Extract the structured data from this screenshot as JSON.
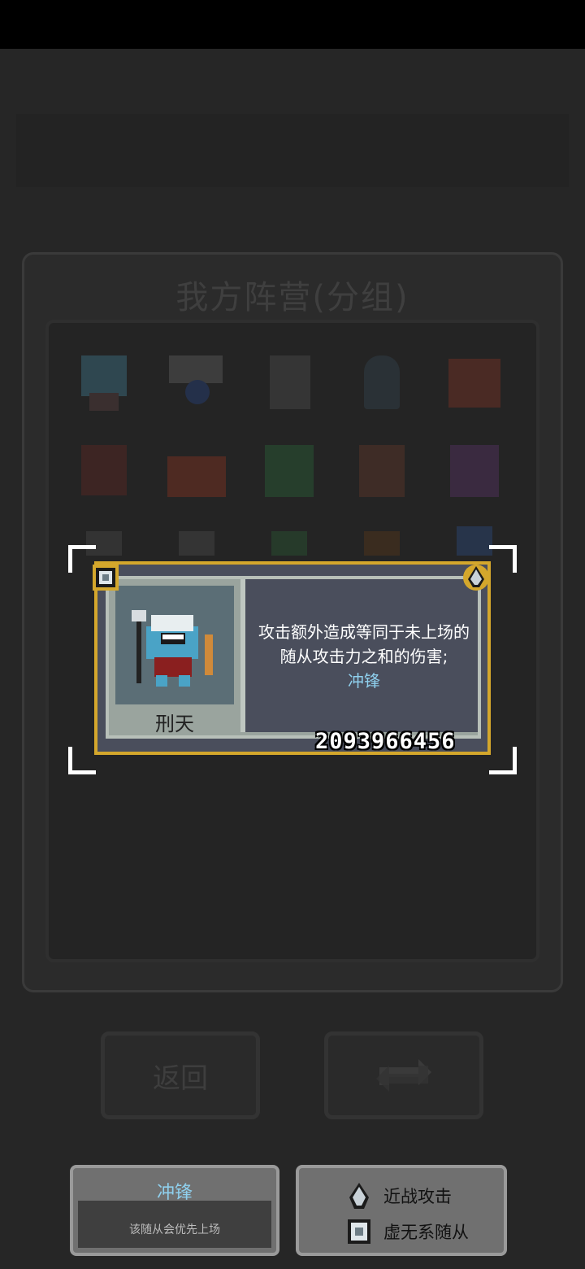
{
  "panel": {
    "title": "我方阵营(分组)"
  },
  "buttons": {
    "back_label": "返回",
    "swap_icon": "swap-icon"
  },
  "card": {
    "hero_name": "刑天",
    "description": "攻击额外造成等同于未上场的随从攻击力之和的伤害;",
    "skill_tag": "冲锋",
    "id_number": "2093966456"
  },
  "skill_box": {
    "title": "冲锋",
    "desc": "该随从会优先上场"
  },
  "legend": {
    "melee_label": "近战攻击",
    "void_label": "虚无系随从"
  },
  "colors": {
    "card_border": "#d4a72c",
    "tag_color": "#8fd0ee",
    "card_bg": "#4a4e5c"
  }
}
